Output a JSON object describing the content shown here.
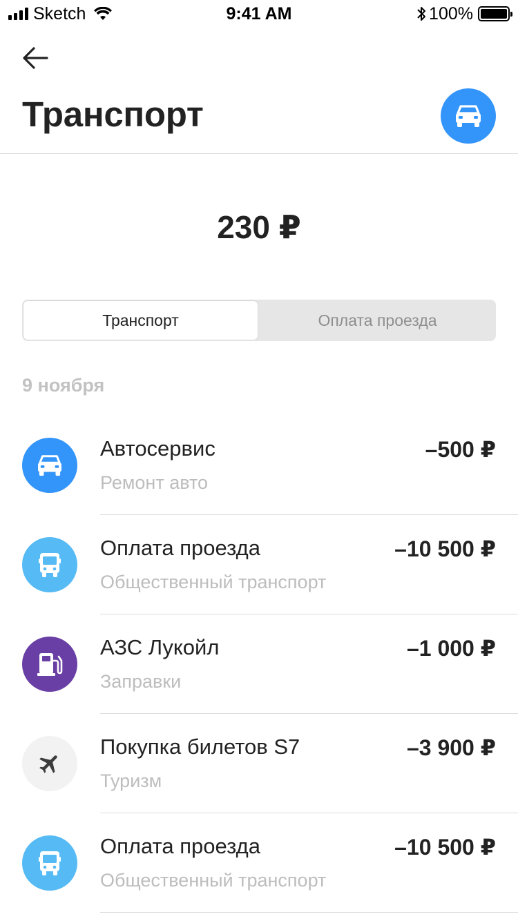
{
  "status_bar": {
    "carrier": "Sketch",
    "time": "9:41 AM",
    "battery": "100%"
  },
  "header": {
    "back_icon": "arrow-left-icon",
    "title": "Транспорт",
    "category_icon": "car-icon",
    "category_color": "#3395fa"
  },
  "total": "230 ₽",
  "segments": [
    {
      "label": "Транспорт",
      "active": true
    },
    {
      "label": "Оплата проезда",
      "active": false
    }
  ],
  "date": "9 ноября",
  "transactions": [
    {
      "name": "Автосервис",
      "category": "Ремонт авто",
      "amount": "–500 ₽",
      "icon": "car-icon",
      "color": "#3395fa"
    },
    {
      "name": "Оплата проезда",
      "category": "Общественный транспорт",
      "amount": "–10 500 ₽",
      "icon": "bus-icon",
      "color": "#56baf4"
    },
    {
      "name": "АЗС Лукойл",
      "category": "Заправки",
      "amount": "–1 000 ₽",
      "icon": "fuel-pump-icon",
      "color": "#6a3fa5"
    },
    {
      "name": "Покупка билетов S7",
      "category": "Туризм",
      "amount": "–3 900 ₽",
      "icon": "airplane-icon",
      "color": "#f2f2f2"
    },
    {
      "name": "Оплата проезда",
      "category": "Общественный транспорт",
      "amount": "–10 500 ₽",
      "icon": "bus-icon",
      "color": "#56baf4"
    }
  ]
}
